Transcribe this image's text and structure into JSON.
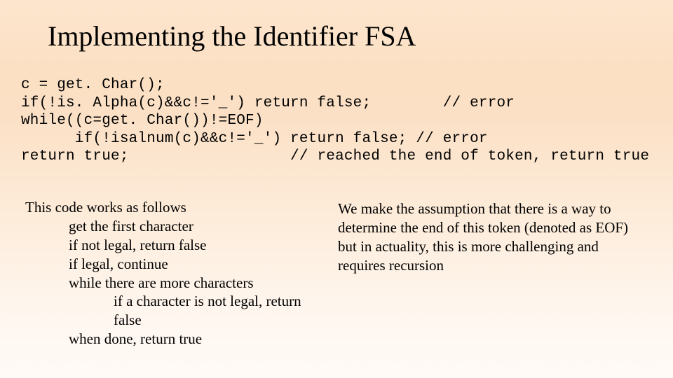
{
  "title": "Implementing the Identifier FSA",
  "code": {
    "l1": "c = get. Char();",
    "l2": "if(!is. Alpha(c)&&c!='_') return false;        // error",
    "l3": "while((c=get. Char())!=EOF)",
    "l4": "      if(!isalnum(c)&&c!='_') return false; // error",
    "l5": "return true;                  // reached the end of token, return true"
  },
  "left": {
    "intro": "This code works as follows",
    "b1": "get the first character",
    "b2": "if not legal, return false",
    "b3": "if legal, continue",
    "b4": "while there are more characters",
    "b5": "if a character is not legal, return false",
    "b6": "when done, return true"
  },
  "right": {
    "text": "We make the assumption that there is a way to determine the end of this token (denoted as EOF) but in actuality, this is more challenging and requires recursion"
  }
}
